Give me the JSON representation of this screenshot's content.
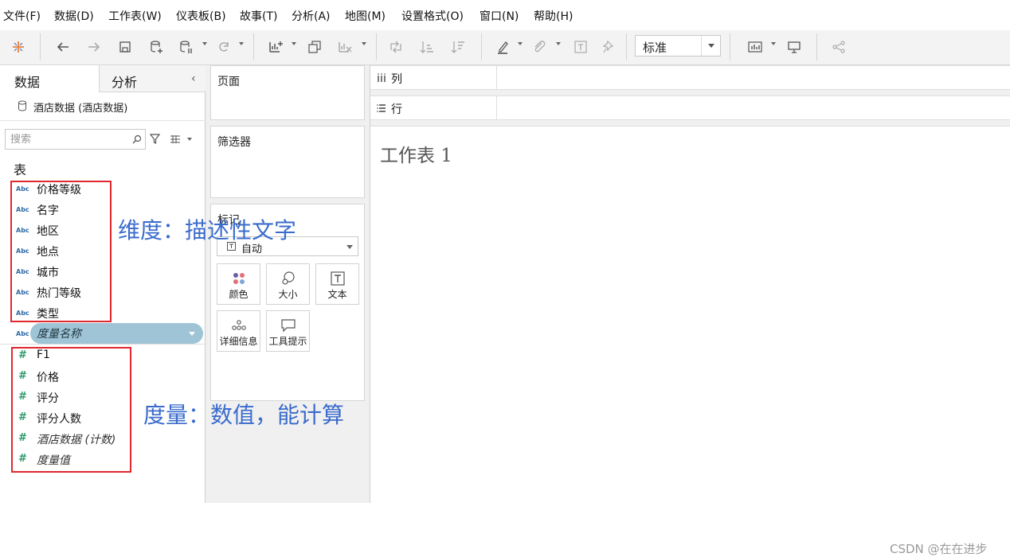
{
  "menu": [
    "文件(F)",
    "数据(D)",
    "工作表(W)",
    "仪表板(B)",
    "故事(T)",
    "分析(A)",
    "地图(M)",
    "设置格式(O)",
    "窗口(N)",
    "帮助(H)"
  ],
  "toolbar": {
    "fit_value": "标准"
  },
  "left_panel": {
    "tab_data": "数据",
    "tab_analysis": "分析",
    "collapse": "‹",
    "datasource": "酒店数据 (酒店数据)",
    "search_placeholder": "搜索",
    "table_heading": "表",
    "dimension_type_label": "Abc",
    "dimensions": [
      "价格等级",
      "名字",
      "地区",
      "地点",
      "城市",
      "热门等级",
      "类型"
    ],
    "measure_names": "度量名称",
    "measures": [
      "F1",
      "价格",
      "评分",
      "评分人数",
      "酒店数据 (计数)",
      "度量值"
    ],
    "measure_icon": "#"
  },
  "annotations": {
    "dimensions": "维度：描述性文字",
    "measures": "度量：数值，能计算"
  },
  "cards": {
    "pages": "页面",
    "filters": "筛选器",
    "marks": "标记",
    "marks_type": "自动",
    "mark_buttons": [
      "颜色",
      "大小",
      "文本",
      "详细信息",
      "工具提示"
    ]
  },
  "shelves": {
    "columns": "列",
    "rows": "行"
  },
  "sheet": {
    "title": "工作表 1"
  },
  "watermark": "CSDN @在在进步",
  "colors": {
    "annotation": "#3a6bcc",
    "highlight_box": "#e0282e",
    "pill": "#9ec4d6"
  }
}
